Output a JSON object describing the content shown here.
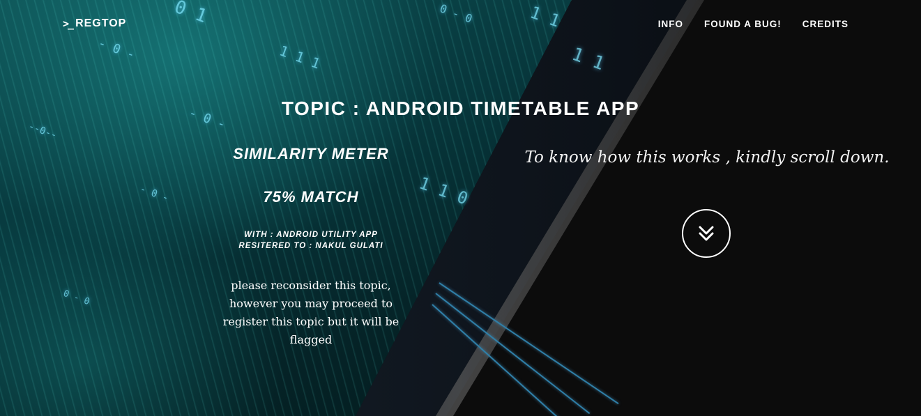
{
  "nav": {
    "brand": "REGTOP",
    "brand_icon": "terminal-prompt-icon",
    "links": [
      "INFO",
      "FOUND A BUG!",
      "CREDITS"
    ]
  },
  "main": {
    "topic_title": "TOPIC : ANDROID TIMETABLE APP",
    "meter_title": "SIMILARITY METER",
    "match": "75% MATCH",
    "with_line": "WITH : ANDROID UTILITY APP",
    "registered_line": "RESITERED TO : NAKUL GULATI",
    "warning": "please reconsider this topic, however you may proceed to register this topic but it will be flagged"
  },
  "right": {
    "scroll_note": "To know how this works , kindly scroll down.",
    "scroll_icon": "double-chevron-down-icon"
  },
  "colors": {
    "accent": "#7fe8ff",
    "teal": "#0d4f52",
    "text": "#ffffff"
  }
}
